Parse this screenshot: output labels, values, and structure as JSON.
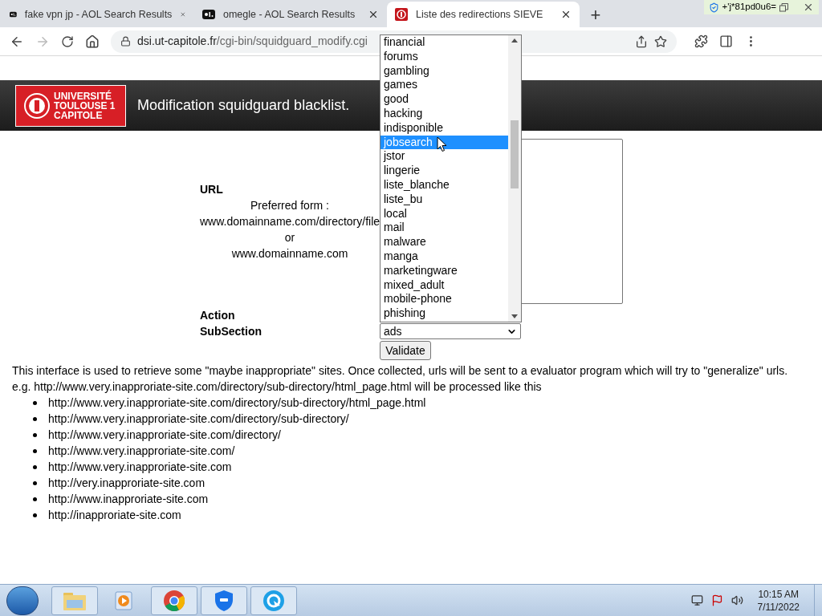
{
  "browser": {
    "tabs": [
      {
        "title": "fake vpn jp - AOL Search Results",
        "kind": "aol",
        "selected": false
      },
      {
        "title": "omegle - AOL Search Results",
        "kind": "aol",
        "selected": false
      },
      {
        "title": "Liste des redirections SIEVE",
        "kind": "sieve",
        "selected": true
      }
    ],
    "new_tab": "+",
    "extension_badge": "+'j*81pd0u6=",
    "forward_disabled": true,
    "address": {
      "domain": "dsi.ut-capitole.fr",
      "path": "/cgi-bin/squidguard_modify.cgi"
    }
  },
  "header": {
    "logo_lines": [
      "UNIVERSITÉ",
      "TOULOUSE 1",
      "CAPITOLE"
    ],
    "title": "Modification squidguard blacklist."
  },
  "form": {
    "url_label": "URL",
    "hint_lines": [
      "Preferred form :",
      "www.domainname.com/directory/file",
      "or",
      "www.domainname.com"
    ],
    "action_label": "Action",
    "subsection_label": "SubSection",
    "subsection_value": "ads",
    "validate": "Validate"
  },
  "dropdown": {
    "options": [
      {
        "label": "financial",
        "selected": false
      },
      {
        "label": "forums",
        "selected": false
      },
      {
        "label": "gambling",
        "selected": false
      },
      {
        "label": "games",
        "selected": false
      },
      {
        "label": "good",
        "selected": false
      },
      {
        "label": "hacking",
        "selected": false
      },
      {
        "label": "indisponible",
        "selected": false
      },
      {
        "label": "jobsearch",
        "selected": true
      },
      {
        "label": "jstor",
        "selected": false
      },
      {
        "label": "lingerie",
        "selected": false
      },
      {
        "label": "liste_blanche",
        "selected": false
      },
      {
        "label": "liste_bu",
        "selected": false
      },
      {
        "label": "local",
        "selected": false
      },
      {
        "label": "mail",
        "selected": false
      },
      {
        "label": "malware",
        "selected": false
      },
      {
        "label": "manga",
        "selected": false
      },
      {
        "label": "marketingware",
        "selected": false
      },
      {
        "label": "mixed_adult",
        "selected": false
      },
      {
        "label": "mobile-phone",
        "selected": false
      },
      {
        "label": "phishing",
        "selected": false
      }
    ]
  },
  "description": [
    "This interface is used to retrieve some \"maybe inappropriate\" sites. Once collected, urls will be sent to a evaluator program which will try to \"generalize\" urls.",
    "e.g. http://www.very.inapproriate-site.com/directory/sub-directory/html_page.html will be processed like this"
  ],
  "examples": [
    "http://www.very.inapproriate-site.com/directory/sub-directory/html_page.html",
    "http://www.very.inapproriate-site.com/directory/sub-directory/",
    "http://www.very.inapproriate-site.com/directory/",
    "http://www.very.inapproriate-site.com/",
    "http://www.very.inapproriate-site.com",
    "http://very.inapproriate-site.com",
    "http://www.inapproriate-site.com",
    "http://inapproriate-site.com"
  ],
  "taskbar": {
    "apps": [
      {
        "kind": "explorer",
        "running": true
      },
      {
        "kind": "media",
        "running": false
      },
      {
        "kind": "chrome",
        "running": true
      },
      {
        "kind": "shield",
        "running": true
      },
      {
        "kind": "refresh",
        "running": true
      }
    ],
    "time": "10:15 AM",
    "date": "7/11/2022"
  }
}
